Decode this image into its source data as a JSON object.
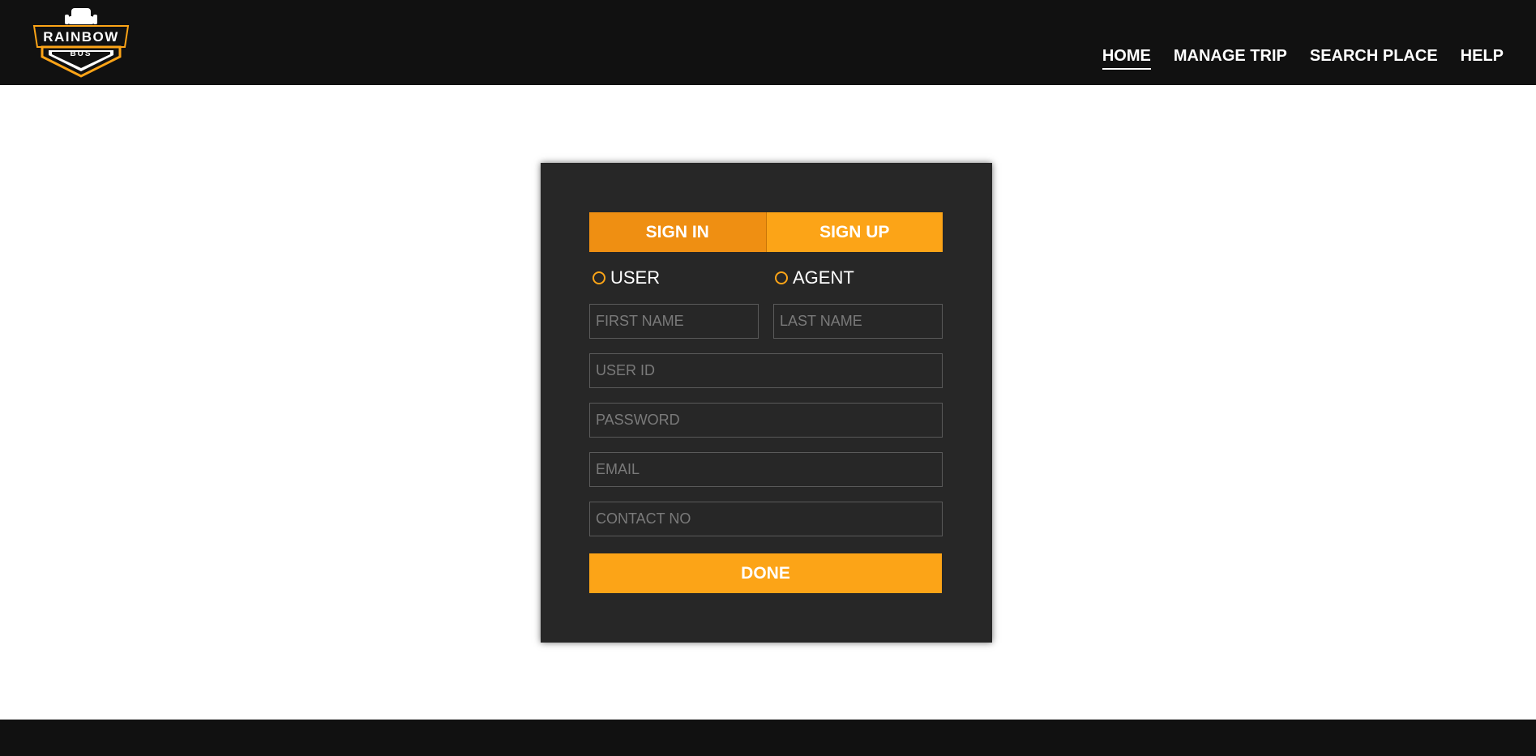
{
  "brand": {
    "name": "RAINBOW",
    "sub": "BUS",
    "logo_icon": "bus-seat-icon",
    "accent": "#fca417"
  },
  "nav": {
    "items": [
      "HOME",
      "MANAGE TRIP",
      "SEARCH PLACE",
      "HELP"
    ],
    "active": "HOME"
  },
  "form": {
    "tabs": {
      "signin": "SIGN IN",
      "signup": "SIGN UP"
    },
    "roles": {
      "user": "USER",
      "agent": "AGENT"
    },
    "fields": {
      "first_name": "FIRST NAME",
      "last_name": "LAST NAME",
      "user_id": "USER ID",
      "password": "PASSWORD",
      "email": "EMAIL",
      "contact": "CONTACT NO"
    },
    "submit": "DONE"
  }
}
